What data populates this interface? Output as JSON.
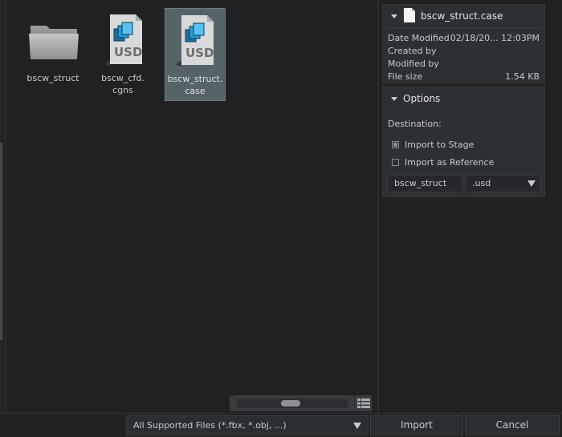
{
  "files": [
    {
      "label": "bscw_struct",
      "icon": "folder-icon",
      "selected": false
    },
    {
      "label": "bscw_cfd.\ncgns",
      "icon": "usd-file-icon",
      "selected": false
    },
    {
      "label": "bscw_struct.\ncase",
      "icon": "usd-file-icon",
      "selected": true
    }
  ],
  "info": {
    "filename": "bscw_struct.case",
    "date_modified_label": "Date Modified",
    "date_modified_value": "02/18/20... 12:03PM",
    "created_by_label": "Created by",
    "modified_by_label": "Modified by",
    "file_size_label": "File size",
    "file_size_value": "1.54 KB"
  },
  "options": {
    "title": "Options",
    "destination_label": "Destination:",
    "import_to_stage": "Import to Stage",
    "import_as_reference": "Import as Reference",
    "selected_destination": "Import to Stage",
    "name_value": "bscw_struct",
    "extension_value": ".usd"
  },
  "footer": {
    "filter_value": "All Supported Files (*.fbx, *.obj, ...)",
    "import_label": "Import",
    "cancel_label": "Cancel"
  },
  "colors": {
    "background": "#1f2123",
    "panel": "#2d3033",
    "selection": "#566369",
    "usd_blue": "#2b9bd6"
  }
}
